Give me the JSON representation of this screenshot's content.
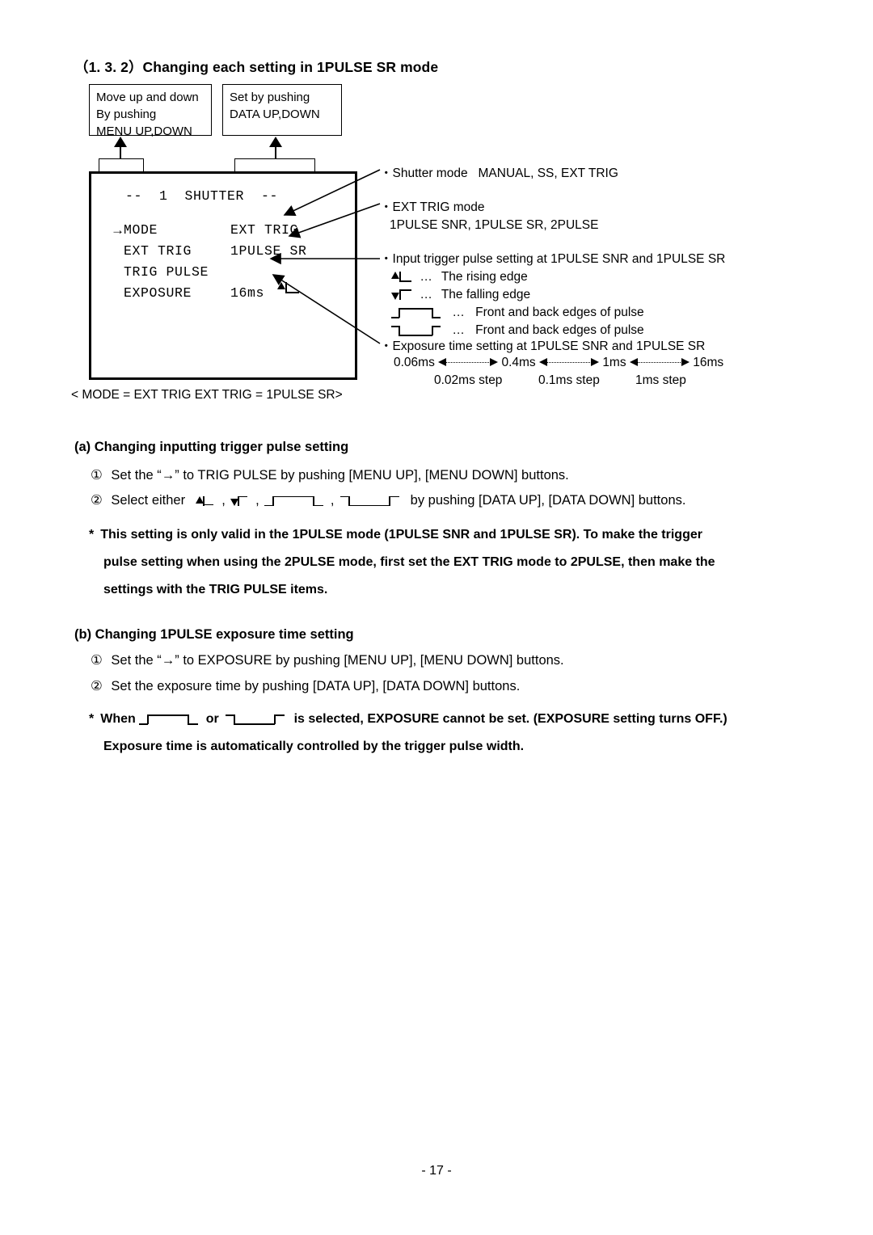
{
  "document": {
    "section_title": "（1. 3. 2）Changing each setting in 1PULSE SR mode",
    "page_number": "- 17 -"
  },
  "callouts": {
    "menu": {
      "line1": "Move up and down",
      "line2": "By pushing",
      "line3": "MENU UP,DOWN"
    },
    "data": {
      "line1": "Set by pushing",
      "line2": "DATA UP,DOWN"
    }
  },
  "monitor": {
    "title": "--  1  SHUTTER  --",
    "cursor": "→",
    "rows": [
      {
        "label": "MODE",
        "value": "EXT TRIG"
      },
      {
        "label": "EXT TRIG",
        "value": "1PULSE SR"
      },
      {
        "label": "TRIG PULSE",
        "value": "rising-edge-glyph"
      },
      {
        "label": "EXPOSURE",
        "value": "16ms"
      }
    ],
    "caption": "< MODE = EXT TRIG   EXT TRIG = 1PULSE SR>"
  },
  "annotations": {
    "shutter_mode": {
      "label": "Shutter mode",
      "values": "MANUAL, SS, EXT TRIG"
    },
    "ext_trig_mode": {
      "label": "EXT TRIG mode",
      "values": "1PULSE SNR, 1PULSE SR, 2PULSE"
    },
    "trig_pulse": {
      "label": "Input trigger pulse setting at 1PULSE SNR and 1PULSE SR",
      "items": [
        {
          "icon": "rising-edge-icon",
          "dots": "…",
          "text": "The rising edge"
        },
        {
          "icon": "falling-edge-icon",
          "dots": "…",
          "text": "The falling edge"
        },
        {
          "icon": "positive-pulse-icon",
          "dots": "…",
          "text": "Front and back edges of pulse"
        },
        {
          "icon": "negative-pulse-icon",
          "dots": "…",
          "text": "Front and back edges of pulse"
        }
      ]
    },
    "exposure": {
      "label": "Exposure time setting at 1PULSE SNR and 1PULSE SR",
      "points": [
        "0.06ms",
        "0.4ms",
        "1ms",
        "16ms"
      ],
      "steps": [
        "0.02ms step",
        "0.1ms step",
        "1ms step"
      ]
    }
  },
  "section_a": {
    "heading": "(a) Changing inputting trigger pulse setting",
    "step1_num": "①",
    "step1": "Set the “→” to TRIG PULSE by pushing [MENU UP], [MENU DOWN] buttons.",
    "step2_num": "②",
    "step2_pre": "Select either",
    "step2_post": "by pushing [DATA UP], [DATA DOWN] buttons.",
    "note_star": "*",
    "note_line1": "This setting is only valid in the 1PULSE mode (1PULSE SNR and 1PULSE SR). To make the trigger",
    "note_line2": "pulse setting when using the 2PULSE mode, first set the EXT TRIG mode to 2PULSE, then make the",
    "note_line3": "settings with the TRIG PULSE items."
  },
  "section_b": {
    "heading": "(b) Changing 1PULSE exposure time setting",
    "step1_num": "①",
    "step1": "Set the “→” to EXPOSURE by pushing [MENU UP], [MENU DOWN] buttons.",
    "step2_num": "②",
    "step2": "Set the exposure time by pushing [DATA UP], [DATA DOWN] buttons.",
    "note_star": "*",
    "note_when": "When",
    "note_or": "or",
    "note_tail": "is selected, EXPOSURE cannot be set. (EXPOSURE setting turns OFF.)",
    "note_line2": "Exposure time is automatically controlled by the trigger pulse width."
  },
  "colors": {
    "ink": "#000000",
    "paper": "#ffffff"
  }
}
